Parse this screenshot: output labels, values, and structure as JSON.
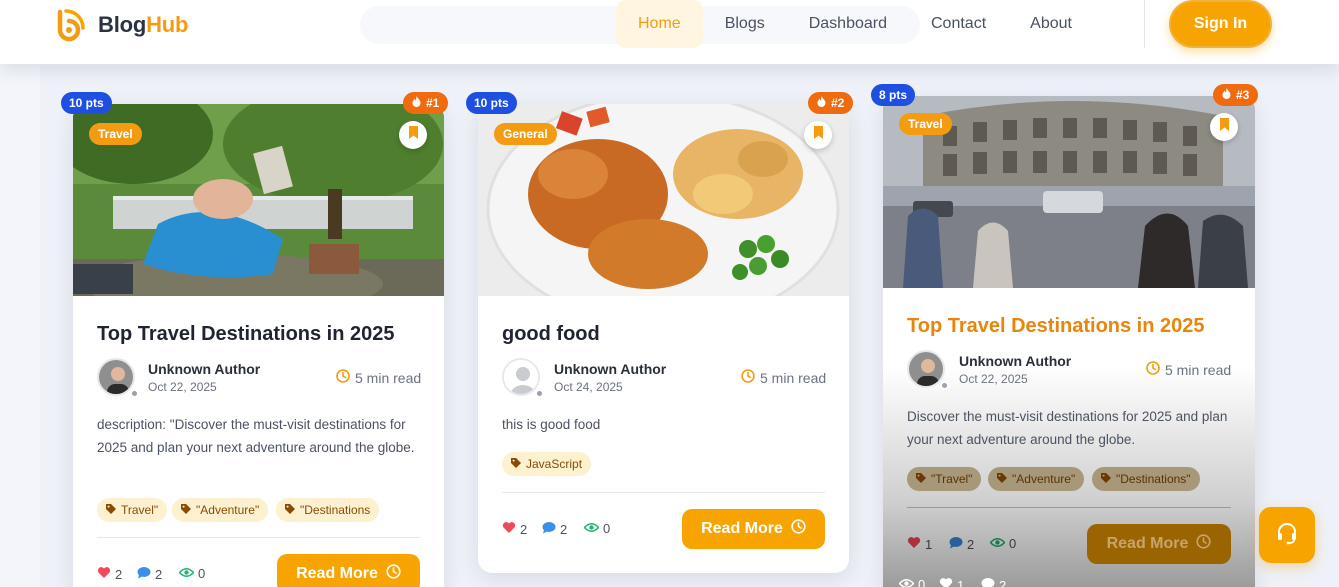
{
  "brand": {
    "name_part1": "Blog",
    "name_part2": "Hub"
  },
  "nav": {
    "items": [
      {
        "label": "Home",
        "active": true
      },
      {
        "label": "Blogs",
        "active": false
      },
      {
        "label": "Dashboard",
        "active": false
      },
      {
        "label": "Contact",
        "active": false
      },
      {
        "label": "About",
        "active": false
      }
    ],
    "sign_in": "Sign In"
  },
  "colors": {
    "accent": "#f7a400",
    "brand_orange": "#f39c12",
    "points_blue": "#1e4fe0",
    "rank_orange": "#f06a10"
  },
  "cards": [
    {
      "points": "10 pts",
      "rank": "#1",
      "category": "Travel",
      "title": "Top Travel Destinations in 2025",
      "author": "Unknown Author",
      "date": "Oct 22, 2025",
      "read_time": "5 min read",
      "description": "description: \"Discover the must-visit destinations for 2025 and plan your next adventure around the globe.",
      "tags": [
        "Travel\"",
        "\"Adventure\"",
        "\"Destinations"
      ],
      "likes": "2",
      "comments": "2",
      "views": "0",
      "read_more": "Read More"
    },
    {
      "points": "10 pts",
      "rank": "#2",
      "category": "General",
      "title": "good food",
      "author": "Unknown Author",
      "date": "Oct 24, 2025",
      "read_time": "5 min read",
      "description": "this is good food",
      "tags": [
        "JavaScript"
      ],
      "likes": "2",
      "comments": "2",
      "views": "0",
      "read_more": "Read More"
    },
    {
      "points": "8 pts",
      "rank": "#3",
      "category": "Travel",
      "title": "Top Travel Destinations in 2025",
      "author": "Unknown Author",
      "date": "Oct 22, 2025",
      "read_time": "5 min read",
      "description": "Discover the must-visit destinations for 2025 and plan your next adventure around the globe.",
      "tags": [
        "\"Travel\"",
        "\"Adventure\"",
        "\"Destinations\""
      ],
      "likes": "1",
      "comments": "2",
      "views": "0",
      "read_more": "Read More",
      "footer_views": "0",
      "footer_likes": "1",
      "footer_comments": "2"
    }
  ]
}
